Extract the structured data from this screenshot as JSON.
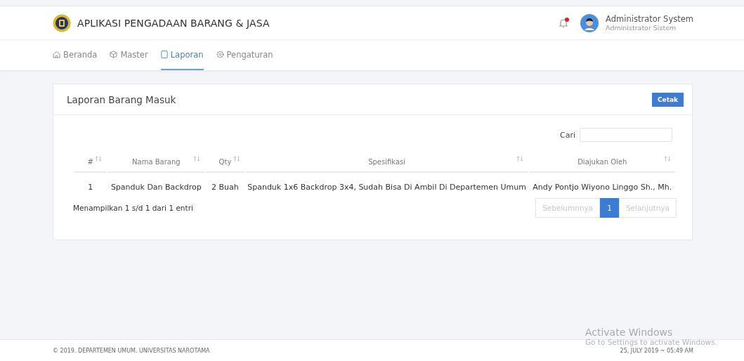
{
  "header": {
    "title": "APLIKASI PENGADAAN BARANG & JASA",
    "notification_unread": true,
    "user": {
      "name": "Administrator System",
      "role": "Administrator Sistem"
    }
  },
  "nav": [
    {
      "label": "Beranda",
      "selected": false
    },
    {
      "label": "Master",
      "selected": false
    },
    {
      "label": "Laporan",
      "selected": true
    },
    {
      "label": "Pengaturan",
      "selected": false
    }
  ],
  "card": {
    "title": "Laporan Barang Masuk",
    "print_button": "Cetak",
    "search_label": "Cari",
    "table": {
      "columns": [
        "#",
        "Nama Barang",
        "Qty",
        "Spesifikasi",
        "Diajukan Oleh"
      ],
      "rows": [
        [
          "1",
          "Spanduk Dan Backdrop",
          "2 Buah",
          "Spanduk 1x6 Backdrop 3x4, Sudah Bisa Di Ambil Di Departemen Umum",
          "Andy Pontjo Wiyono Linggo Sh., Mh."
        ]
      ]
    },
    "info": "Menampilkan 1 s/d 1 dari 1 entri",
    "pagination": [
      {
        "label": "Sebelumnnya",
        "disabled": true,
        "selected": false
      },
      {
        "label": "1",
        "disabled": false,
        "selected": true
      },
      {
        "label": "Selanjutnya",
        "disabled": true,
        "selected": false
      }
    ]
  },
  "footer": {
    "copyright": "© 2019. DEPARTEMEN UMUM. UNIVERSITAS NAROTAMA",
    "datetime": "25, JULY 2019 ~ 05:49 AM"
  },
  "os_overlay": {
    "title": "Activate Windows",
    "subtitle": "Go to Settings to activate Windows."
  }
}
